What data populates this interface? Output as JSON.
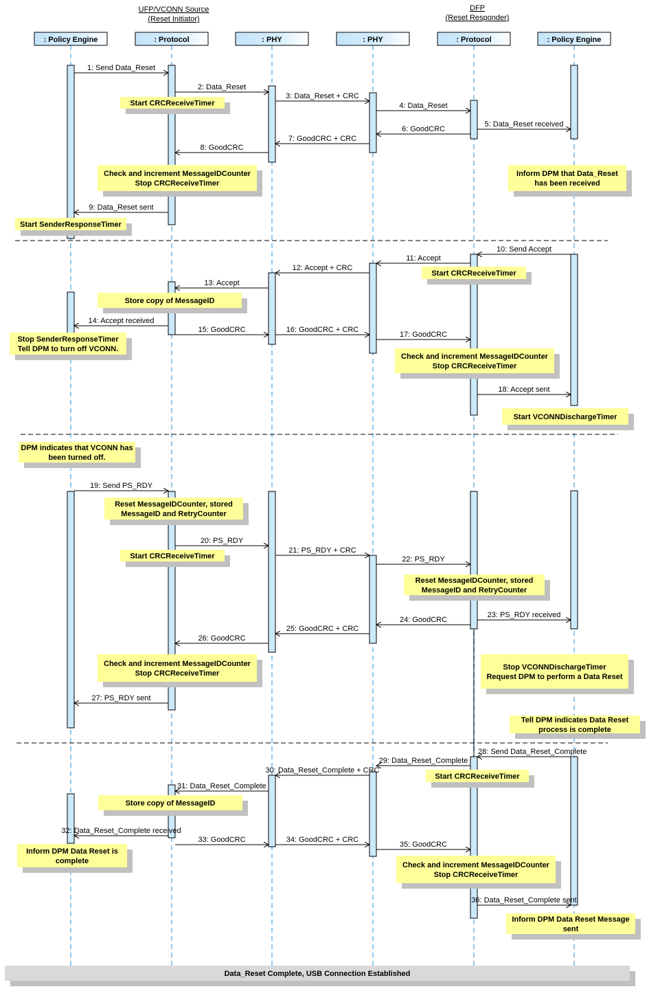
{
  "groups": [
    {
      "title": "UFP/VCONN Source",
      "subtitle": "(Reset Initiator)"
    },
    {
      "title": "DFP",
      "subtitle": "(Reset Responder)"
    }
  ],
  "lifelines": [
    ": Policy Engine",
    ": Protocol",
    ": PHY",
    ": PHY",
    ": Protocol",
    ": Policy Engine"
  ],
  "messages": [
    {
      "from": 0,
      "to": 1,
      "label": "1: Send Data_Reset"
    },
    {
      "from": 1,
      "to": 2,
      "label": "2: Data_Reset"
    },
    {
      "from": 2,
      "to": 3,
      "label": "3: Data_Reset + CRC"
    },
    {
      "from": 3,
      "to": 4,
      "label": "4: Data_Reset"
    },
    {
      "from": 4,
      "to": 5,
      "label": "5: Data_Reset received"
    },
    {
      "from": 4,
      "to": 3,
      "label": "6: GoodCRC"
    },
    {
      "from": 3,
      "to": 2,
      "label": "7: GoodCRC + CRC"
    },
    {
      "from": 2,
      "to": 1,
      "label": "8: GoodCRC"
    },
    {
      "from": 1,
      "to": 0,
      "label": "9: Data_Reset sent"
    },
    {
      "from": 5,
      "to": 4,
      "label": "10: Send Accept"
    },
    {
      "from": 4,
      "to": 3,
      "label": "11: Accept"
    },
    {
      "from": 3,
      "to": 2,
      "label": "12: Accept + CRC"
    },
    {
      "from": 2,
      "to": 1,
      "label": "13: Accept"
    },
    {
      "from": 1,
      "to": 0,
      "label": "14: Accept received"
    },
    {
      "from": 1,
      "to": 2,
      "label": "15: GoodCRC"
    },
    {
      "from": 2,
      "to": 3,
      "label": "16: GoodCRC + CRC"
    },
    {
      "from": 3,
      "to": 4,
      "label": "17: GoodCRC"
    },
    {
      "from": 4,
      "to": 5,
      "label": "18: Accept sent"
    },
    {
      "from": 0,
      "to": 1,
      "label": "19: Send PS_RDY"
    },
    {
      "from": 1,
      "to": 2,
      "label": "20: PS_RDY"
    },
    {
      "from": 2,
      "to": 3,
      "label": "21: PS_RDY + CRC"
    },
    {
      "from": 3,
      "to": 4,
      "label": "22: PS_RDY"
    },
    {
      "from": 4,
      "to": 5,
      "label": "23: PS_RDY received"
    },
    {
      "from": 4,
      "to": 3,
      "label": "24: GoodCRC"
    },
    {
      "from": 3,
      "to": 2,
      "label": "25: GoodCRC + CRC"
    },
    {
      "from": 2,
      "to": 1,
      "label": "26: GoodCRC"
    },
    {
      "from": 1,
      "to": 0,
      "label": "27: PS_RDY sent"
    },
    {
      "from": 5,
      "to": 4,
      "label": "28: Send Data_Reset_Complete"
    },
    {
      "from": 4,
      "to": 3,
      "label": "29: Data_Reset_Complete"
    },
    {
      "from": 3,
      "to": 2,
      "label": "30: Data_Reset_Complete + CRC"
    },
    {
      "from": 2,
      "to": 1,
      "label": "31: Data_Reset_Complete"
    },
    {
      "from": 1,
      "to": 0,
      "label": "32: Data_Reset_Complete received"
    },
    {
      "from": 1,
      "to": 2,
      "label": "33: GoodCRC"
    },
    {
      "from": 2,
      "to": 3,
      "label": "34: GoodCRC + CRC"
    },
    {
      "from": 3,
      "to": 4,
      "label": "35: GoodCRC"
    },
    {
      "from": 4,
      "to": 5,
      "label": "36: Data_Reset_Complete sent"
    }
  ],
  "notes": [
    [
      "Start CRCReceiveTimer"
    ],
    [
      "Check and increment MessageIDCounter",
      "Stop CRCReceiveTimer"
    ],
    [
      "Inform DPM that Data_Reset",
      "has been received"
    ],
    [
      "Start SenderResponseTimer"
    ],
    [
      "Start CRCReceiveTimer"
    ],
    [
      "Store copy of MessageID"
    ],
    [
      "Stop SenderResponseTimer",
      "Tell DPM to turn off VCONN."
    ],
    [
      "Check and increment MessageIDCounter",
      "Stop CRCReceiveTimer"
    ],
    [
      "Start VCONNDischargeTimer"
    ],
    [
      "DPM indicates that VCONN has",
      "been turned off."
    ],
    [
      "Reset MessageIDCounter, stored",
      "MessageID and RetryCounter"
    ],
    [
      "Start CRCReceiveTimer"
    ],
    [
      "Reset MessageIDCounter, stored",
      "MessageID and RetryCounter"
    ],
    [
      "Check and increment MessageIDCounter",
      "Stop CRCReceiveTimer"
    ],
    [
      "Stop VCONNDischargeTimer",
      "Request DPM to perform a Data Reset"
    ],
    [
      "Tell DPM indicates Data Reset",
      "process is complete"
    ],
    [
      "Start CRCReceiveTimer"
    ],
    [
      "Store copy of MessageID"
    ],
    [
      "Inform DPM Data Reset is",
      "complete"
    ],
    [
      "Check and increment MessageIDCounter",
      "Stop CRCReceiveTimer"
    ],
    [
      "Inform DPM Data Reset Message",
      "sent"
    ]
  ],
  "footer": "Data_Reset Complete, USB Connection Established",
  "colors": {
    "note": "#ffff99",
    "shadow": "#c0c0c0",
    "lifeline": "#8ec8f0",
    "activation": "#cce9fb",
    "footer": "#d9d9d9"
  }
}
